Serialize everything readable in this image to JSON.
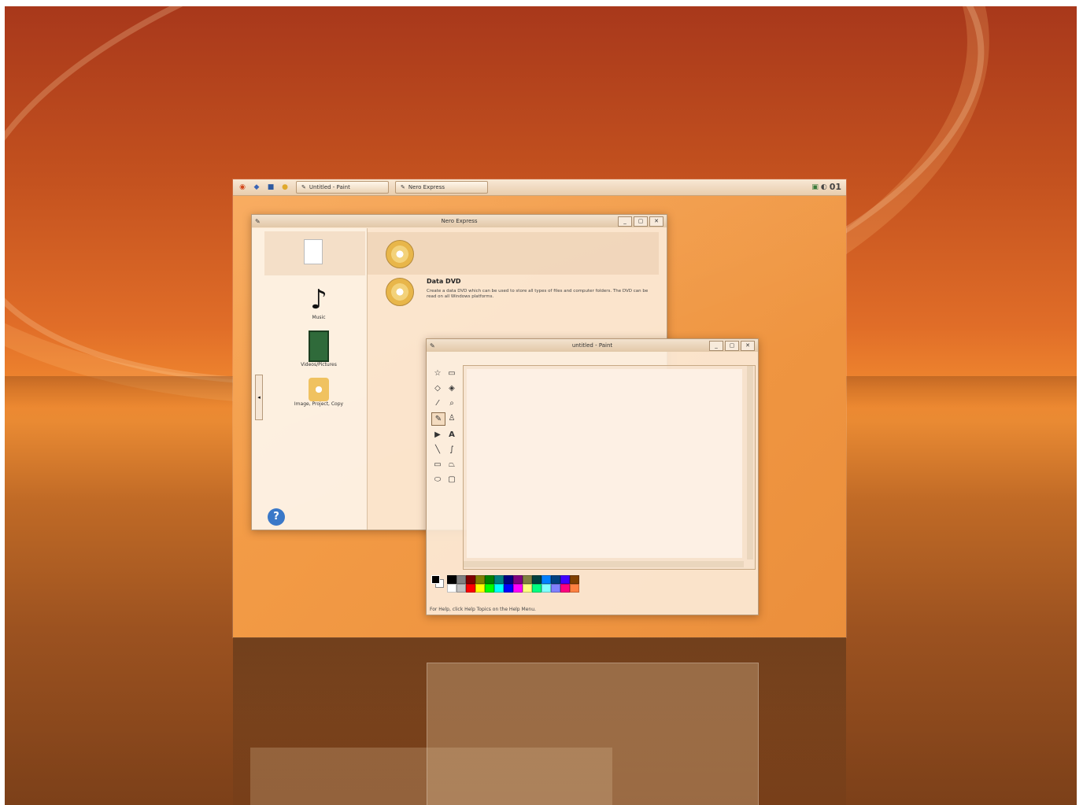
{
  "taskbar": {
    "tasks": [
      {
        "label": "Untitled - Paint",
        "icon": "paint-icon"
      },
      {
        "label": "Nero Express",
        "icon": "nero-icon"
      }
    ],
    "clock": "01"
  },
  "nero": {
    "title": "Nero Express",
    "sidebar": [
      {
        "label": "Music",
        "icon": "music-note-icon"
      },
      {
        "label": "Videos/Pictures",
        "icon": "film-icon"
      },
      {
        "label": "Image, Project, Copy",
        "icon": "disc-image-icon"
      }
    ],
    "option": {
      "title": "Data DVD",
      "description": "Create a data DVD which can be used to store all types of files and computer folders. The DVD can be read on all Windows platforms."
    }
  },
  "paint": {
    "title": "untitled - Paint",
    "tools": [
      "free-select",
      "rect-select",
      "eraser",
      "fill",
      "eyedropper",
      "magnifier",
      "pencil",
      "brush",
      "airbrush",
      "text",
      "line",
      "curve",
      "rectangle",
      "polygon",
      "ellipse",
      "rounded-rectangle"
    ],
    "palette": [
      "#000000",
      "#808080",
      "#800000",
      "#808000",
      "#008000",
      "#008080",
      "#000080",
      "#800080",
      "#808040",
      "#004040",
      "#0080ff",
      "#004080",
      "#4000ff",
      "#804000",
      "#ffffff",
      "#c0c0c0",
      "#ff0000",
      "#ffff00",
      "#00ff00",
      "#00ffff",
      "#0000ff",
      "#ff00ff",
      "#ffff80",
      "#00ff80",
      "#80ffff",
      "#8080ff",
      "#ff0080",
      "#ff8040"
    ],
    "status": "For Help, click Help Topics on the Help Menu."
  }
}
